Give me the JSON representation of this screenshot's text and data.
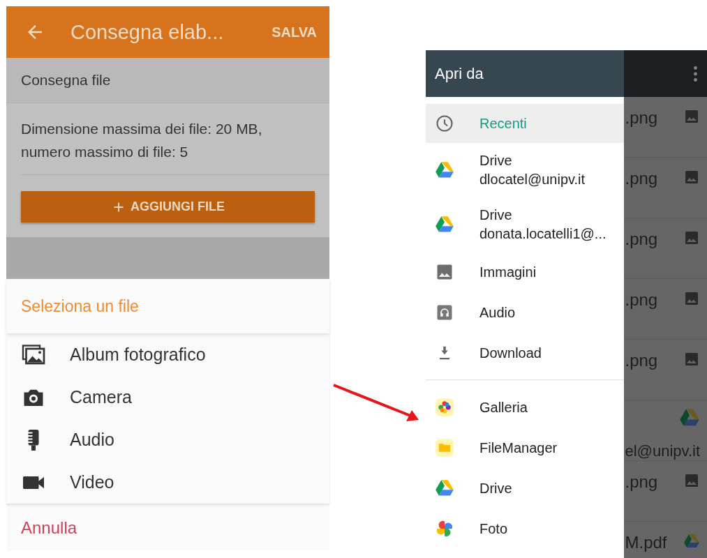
{
  "left_screen": {
    "app_bar": {
      "title": "Consegna elab...",
      "action": "SALVA"
    },
    "section_title": "Consegna file",
    "limits_text": "Dimensione massima dei file: 20 MB, numero massimo di file: 5",
    "add_button": {
      "label": "AGGIUNGI FILE"
    },
    "sheet": {
      "title": "Seleziona un file",
      "options": [
        {
          "kind": "album",
          "label": "Album fotografico"
        },
        {
          "kind": "camera",
          "label": "Camera"
        },
        {
          "kind": "audio",
          "label": "Audio"
        },
        {
          "kind": "video",
          "label": "Video"
        }
      ],
      "cancel": "Annulla"
    }
  },
  "right_screen": {
    "drawer": {
      "title": "Apri da",
      "roots": [
        {
          "kind": "recent",
          "title": "Recenti",
          "selected": true
        },
        {
          "kind": "drive",
          "title": "Drive",
          "subtitle": "dlocatel@unipv.it",
          "selected": false
        },
        {
          "kind": "drive",
          "title": "Drive",
          "subtitle": "donata.locatelli1@...",
          "selected": false
        },
        {
          "kind": "images",
          "title": "Immagini",
          "selected": false
        },
        {
          "kind": "audio",
          "title": "Audio",
          "selected": false
        },
        {
          "kind": "download",
          "title": "Download",
          "selected": false
        }
      ],
      "apps": [
        {
          "kind": "gallery",
          "title": "Galleria",
          "selected": false
        },
        {
          "kind": "filemanager",
          "title": "FileManager",
          "selected": false
        },
        {
          "kind": "drive",
          "title": "Drive",
          "selected": false
        },
        {
          "kind": "photos",
          "title": "Foto",
          "selected": false
        }
      ]
    },
    "background_list": {
      "rows": [
        {
          "kind": "image",
          "name": ".png"
        },
        {
          "kind": "image",
          "name": ".png"
        },
        {
          "kind": "image",
          "name": ".png"
        },
        {
          "kind": "image",
          "name": ".png"
        },
        {
          "kind": "image",
          "name": ".png"
        },
        {
          "kind": "drive_account",
          "name": "el@unipv.it"
        },
        {
          "kind": "image",
          "name": ".png"
        },
        {
          "kind": "drive_file",
          "name": "M.pdf"
        }
      ]
    }
  }
}
